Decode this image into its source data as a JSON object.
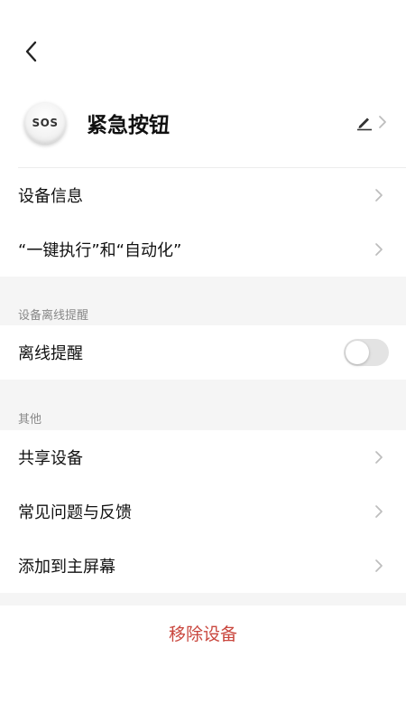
{
  "header": {
    "back_icon": "chevron-left-icon"
  },
  "device": {
    "avatar_text": "SOS",
    "name": "紧急按钮",
    "edit_icon": "pencil-icon"
  },
  "main_items": [
    {
      "label": "设备信息"
    },
    {
      "label": "“一键执行”和“自动化”"
    }
  ],
  "offline_section": {
    "title": "设备离线提醒",
    "item_label": "离线提醒",
    "toggle_on": false
  },
  "other_section": {
    "title": "其他",
    "items": [
      {
        "label": "共享设备"
      },
      {
        "label": "常见问题与反馈"
      },
      {
        "label": "添加到主屏幕"
      }
    ]
  },
  "remove_label": "移除设备",
  "colors": {
    "remove_text": "#c9463d",
    "toggle_off": "#e3e3e3",
    "section_bg": "#f5f5f5"
  }
}
